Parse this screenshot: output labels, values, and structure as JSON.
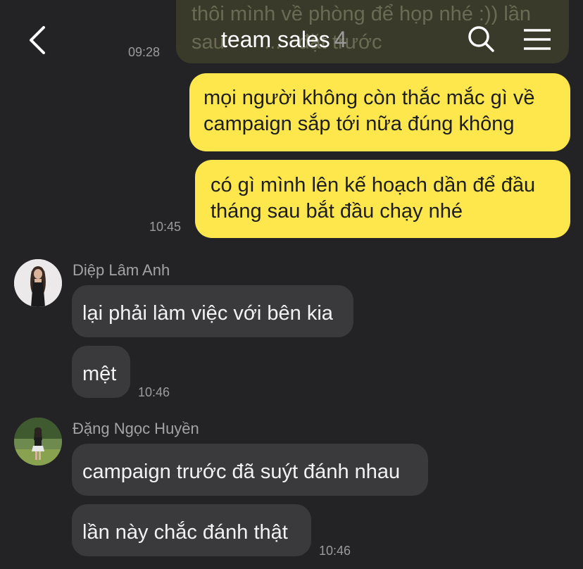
{
  "header": {
    "title": "team sales",
    "member_count": "4",
    "back_icon": "chevron-left-icon",
    "search_icon": "search-icon",
    "menu_icon": "hamburger-menu-icon"
  },
  "messages": {
    "partial_top_text": "thôi mình về phòng để họp nhé :)) lần\nsau       ...   đặt trước",
    "partial_top_time": "09:28",
    "me_1": "mọi người không còn thắc mắc gì về\ncampaign sắp tới nữa đúng không",
    "me_2": "có gì mình lên kế hoạch dần để đầu\ntháng sau bắt đầu chạy nhé",
    "me_time": "10:45",
    "sender_1": "Diệp Lâm Anh",
    "s1_msg_1": "lại phải làm việc với bên kia",
    "s1_msg_2": "mệt",
    "s1_time": "10:46",
    "sender_2": "Đặng Ngọc Huyền",
    "s2_msg_1": "campaign trước đã suýt đánh nhau",
    "s2_msg_2": "lần này chắc đánh thật",
    "s2_time": "10:46"
  },
  "colors": {
    "background": "#232326",
    "my_bubble": "#fde74c",
    "other_bubble": "#3a3a3d"
  }
}
